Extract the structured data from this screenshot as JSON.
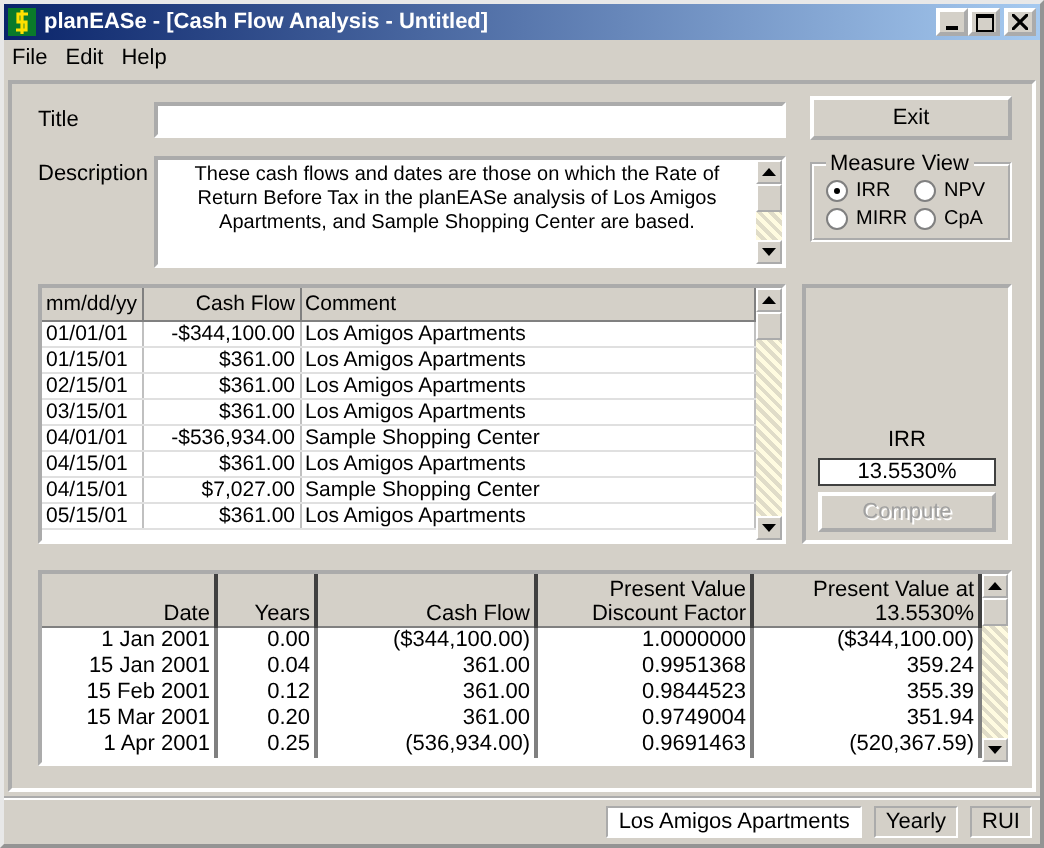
{
  "window": {
    "title": "planEASe - [Cash Flow Analysis - Untitled]"
  },
  "menu": [
    "File",
    "Edit",
    "Help"
  ],
  "title_field": {
    "label": "Title"
  },
  "description": {
    "label": "Description",
    "value": "These cash flows and dates are those on which the Rate of Return Before Tax in the planEASe analysis of Los Amigos Apartments, and Sample Shopping Center are based."
  },
  "exit_button": {
    "label": "Exit",
    "disabled": false
  },
  "measure_view": {
    "label": "Measure View",
    "options": [
      {
        "label": "IRR",
        "selected": true
      },
      {
        "label": "NPV",
        "selected": false
      },
      {
        "label": "MIRR",
        "selected": false
      },
      {
        "label": "CpA",
        "selected": false
      }
    ]
  },
  "cash_flow_table": {
    "columns": [
      "mm/dd/yy",
      "Cash Flow",
      "Comment"
    ],
    "rows": [
      [
        "01/01/01",
        "-$344,100.00",
        "Los Amigos Apartments"
      ],
      [
        "01/15/01",
        "$361.00",
        "Los Amigos Apartments"
      ],
      [
        "02/15/01",
        "$361.00",
        "Los Amigos Apartments"
      ],
      [
        "03/15/01",
        "$361.00",
        "Los Amigos Apartments"
      ],
      [
        "04/01/01",
        "-$536,934.00",
        "Sample Shopping Center"
      ],
      [
        "04/15/01",
        "$361.00",
        "Los Amigos Apartments"
      ],
      [
        "04/15/01",
        "$7,027.00",
        "Sample Shopping Center"
      ],
      [
        "05/15/01",
        "$361.00",
        "Los Amigos Apartments"
      ]
    ]
  },
  "result": {
    "label": "IRR",
    "value": "13.5530%",
    "compute_button": {
      "label": "Compute",
      "disabled": true
    }
  },
  "analysis_table": {
    "columns": [
      "Date",
      "Years",
      "Cash Flow",
      "Present Value Discount Factor",
      "Present Value at 13.5530%"
    ],
    "rows": [
      [
        "1 Jan 2001",
        "0.00",
        "($344,100.00)",
        "1.0000000",
        "($344,100.00)"
      ],
      [
        "15 Jan 2001",
        "0.04",
        "361.00",
        "0.9951368",
        "359.24"
      ],
      [
        "15 Feb 2001",
        "0.12",
        "361.00",
        "0.9844523",
        "355.39"
      ],
      [
        "15 Mar 2001",
        "0.20",
        "361.00",
        "0.9749004",
        "351.94"
      ],
      [
        "1 Apr 2001",
        "0.25",
        "(536,934.00)",
        "0.9691463",
        "(520,367.59)"
      ]
    ]
  },
  "status_bar": [
    "Los Amigos Apartments",
    "Yearly",
    "RUI"
  ]
}
